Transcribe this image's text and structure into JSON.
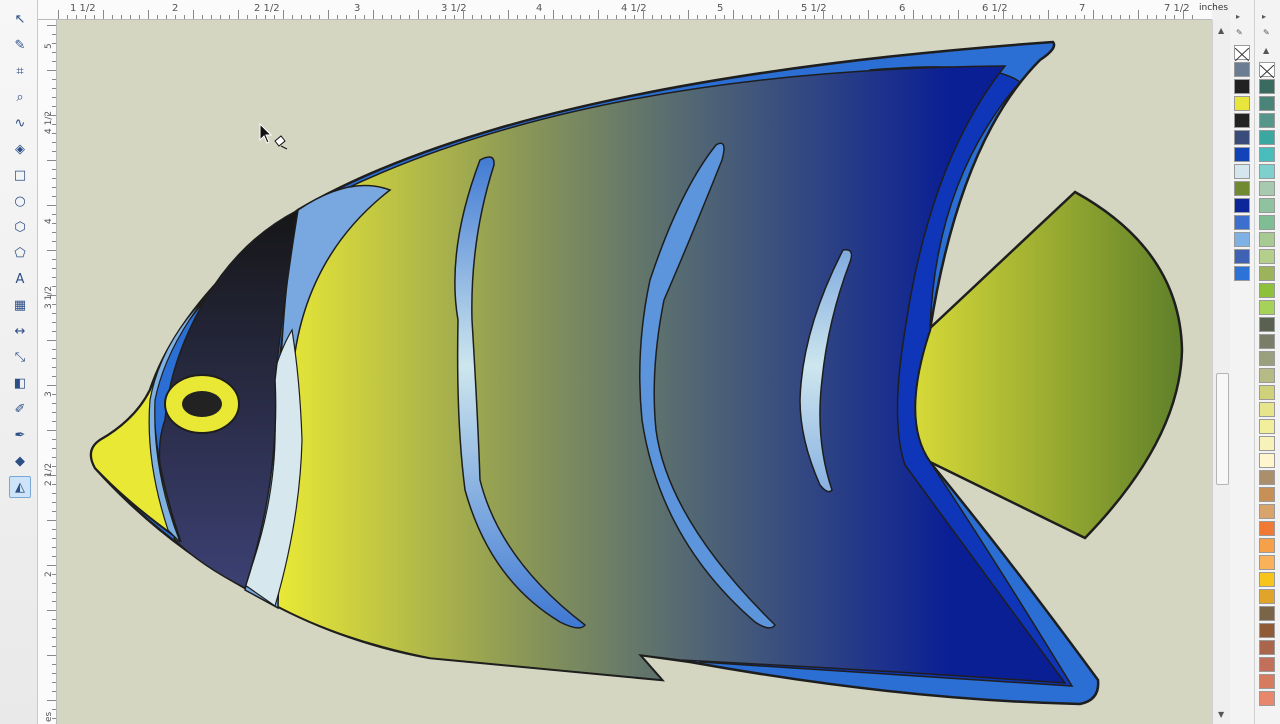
{
  "ruler": {
    "units": "inches",
    "h_labels": [
      "1 1/2",
      "2",
      "2 1/2",
      "3",
      "3 1/2",
      "4",
      "4 1/2",
      "5",
      "5 1/2",
      "6",
      "6 1/2",
      "7",
      "7 1/2"
    ],
    "v_labels": [
      "5",
      "4 1/2",
      "4",
      "3 1/2",
      "3",
      "2 1/2",
      "2"
    ],
    "v_partial": "es"
  },
  "toolbox": {
    "tools": [
      {
        "name": "pick-tool-icon"
      },
      {
        "name": "shape-tool-icon"
      },
      {
        "name": "crop-tool-icon"
      },
      {
        "name": "zoom-tool-icon"
      },
      {
        "name": "freehand-tool-icon"
      },
      {
        "name": "smart-fill-icon"
      },
      {
        "name": "rectangle-tool-icon"
      },
      {
        "name": "ellipse-tool-icon"
      },
      {
        "name": "polygon-tool-icon"
      },
      {
        "name": "basic-shapes-icon"
      },
      {
        "name": "text-tool-icon"
      },
      {
        "name": "table-tool-icon"
      },
      {
        "name": "dimension-tool-icon"
      },
      {
        "name": "connector-tool-icon"
      },
      {
        "name": "interactive-effects-icon"
      },
      {
        "name": "eyedropper-tool-icon"
      },
      {
        "name": "outline-tool-icon"
      },
      {
        "name": "fill-tool-icon"
      },
      {
        "name": "interactive-fill-icon",
        "active": true
      }
    ]
  },
  "palette_doc": [
    "none",
    "#6b7d92",
    "#222222",
    "#e8e63c",
    "#222222",
    "#394c7a",
    "#1343b8",
    "#d6e6ee",
    "#6f8a30",
    "#0b2799",
    "#3d6fcf",
    "#7fb1e4",
    "#3f63b2",
    "#2d72d6"
  ],
  "palette_main": [
    "none",
    "#3a6b60",
    "#4a8377",
    "#56968a",
    "#3aa7a0",
    "#49bcbc",
    "#7ed0cf",
    "#a7c9b0",
    "#8fc29f",
    "#7fbd95",
    "#a7c992",
    "#b3cf8b",
    "#9cb25b",
    "#8fc03b",
    "#a6d25a",
    "#5b6150",
    "#7a7d68",
    "#9aa07d",
    "#b6ba85",
    "#cfd17b",
    "#e7e58c",
    "#f1ef9c",
    "#f6f2b9",
    "#fff6cf",
    "#ab8e6b",
    "#c69056",
    "#d8a46b",
    "#f07a33",
    "#f7a04a",
    "#f9b15a",
    "#f7c51a",
    "#e0a42a",
    "#7a6549",
    "#8f5a36",
    "#a9664a",
    "#c27059",
    "#d67b5e",
    "#e8876c"
  ],
  "colors": {
    "canvas": "#d5d6c1",
    "outline": "#1e1e1e"
  }
}
